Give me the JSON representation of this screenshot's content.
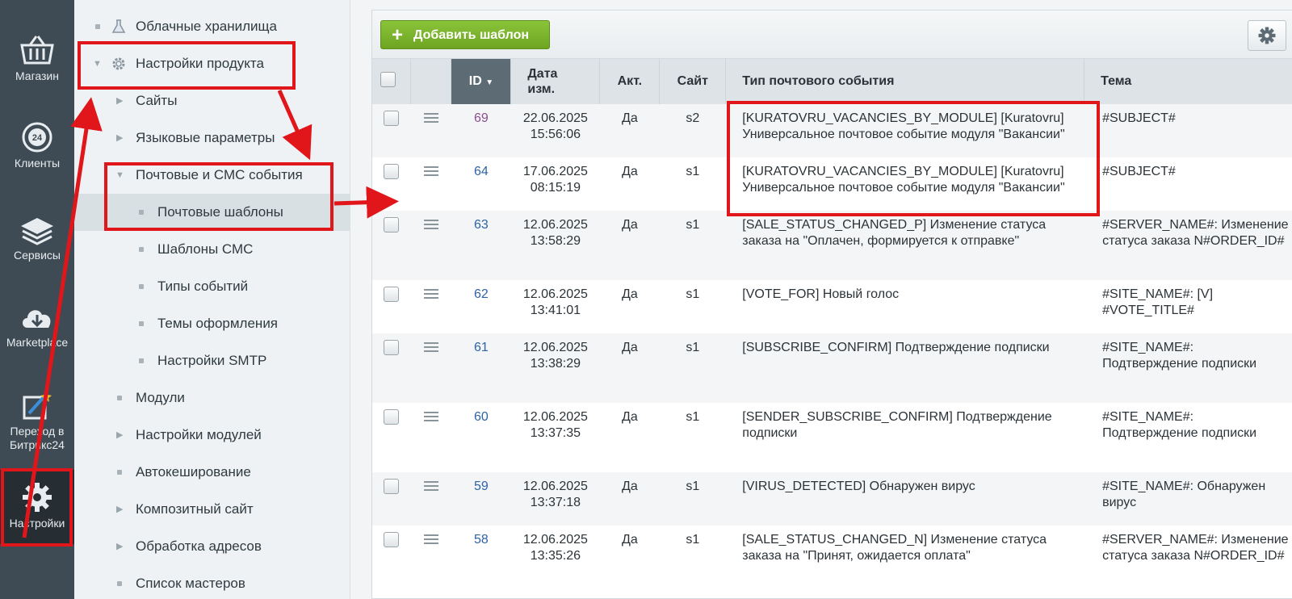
{
  "leftbar": {
    "items": [
      {
        "label": "Магазин",
        "icon": "basket-icon"
      },
      {
        "label": "Клиенты",
        "icon": "clients-24-icon"
      },
      {
        "label": "Сервисы",
        "icon": "layers-icon"
      },
      {
        "label": "Marketplace",
        "icon": "cloud-download-icon"
      },
      {
        "label": "Переход в Битрикс24",
        "icon": "magic-wand-icon"
      },
      {
        "label": "Настройки",
        "icon": "gear-icon"
      }
    ]
  },
  "tree": {
    "items": [
      {
        "label": "Облачные хранилища"
      },
      {
        "label": "Настройки продукта"
      },
      {
        "label": "Сайты"
      },
      {
        "label": "Языковые параметры"
      },
      {
        "label": "Почтовые и СМС события"
      },
      {
        "label": "Почтовые шаблоны"
      },
      {
        "label": "Шаблоны СМС"
      },
      {
        "label": "Типы событий"
      },
      {
        "label": "Темы оформления"
      },
      {
        "label": "Настройки SMTP"
      },
      {
        "label": "Модули"
      },
      {
        "label": "Настройки модулей"
      },
      {
        "label": "Автокеширование"
      },
      {
        "label": "Композитный сайт"
      },
      {
        "label": "Обработка адресов"
      },
      {
        "label": "Список мастеров"
      }
    ]
  },
  "toolbar": {
    "add_label": "Добавить шаблон",
    "accent": "#7ab32e"
  },
  "table": {
    "headers": {
      "id": "ID",
      "date": "Дата изм.",
      "active": "Акт.",
      "site": "Сайт",
      "event_type": "Тип почтового события",
      "subject": "Тема"
    },
    "rows": [
      {
        "id": "69",
        "date": "22.06.2025",
        "time": "15:56:06",
        "active": "Да",
        "site": "s2",
        "event": "[KURATOVRU_VACANCIES_BY_MODULE] [Kuratovru] Универсальное почтовое событие модуля \"Вакансии\"",
        "subject": "#SUBJECT#"
      },
      {
        "id": "64",
        "date": "17.06.2025",
        "time": "08:15:19",
        "active": "Да",
        "site": "s1",
        "event": "[KURATOVRU_VACANCIES_BY_MODULE] [Kuratovru] Универсальное почтовое событие модуля \"Вакансии\"",
        "subject": "#SUBJECT#"
      },
      {
        "id": "63",
        "date": "12.06.2025",
        "time": "13:58:29",
        "active": "Да",
        "site": "s1",
        "event": "[SALE_STATUS_CHANGED_P] Изменение статуса заказа на \"Оплачен, формируется к отправке\"",
        "subject": "#SERVER_NAME#: Изменение статуса заказа N#ORDER_ID#"
      },
      {
        "id": "62",
        "date": "12.06.2025",
        "time": "13:41:01",
        "active": "Да",
        "site": "s1",
        "event": "[VOTE_FOR] Новый голос",
        "subject": "#SITE_NAME#: [V] #VOTE_TITLE#"
      },
      {
        "id": "61",
        "date": "12.06.2025",
        "time": "13:38:29",
        "active": "Да",
        "site": "s1",
        "event": "[SUBSCRIBE_CONFIRM] Подтверждение подписки",
        "subject": "#SITE_NAME#: Подтверждение подписки"
      },
      {
        "id": "60",
        "date": "12.06.2025",
        "time": "13:37:35",
        "active": "Да",
        "site": "s1",
        "event": "[SENDER_SUBSCRIBE_CONFIRM] Подтверждение подписки",
        "subject": "#SITE_NAME#: Подтверждение подписки"
      },
      {
        "id": "59",
        "date": "12.06.2025",
        "time": "13:37:18",
        "active": "Да",
        "site": "s1",
        "event": "[VIRUS_DETECTED] Обнаружен вирус",
        "subject": "#SITE_NAME#: Обнаружен вирус"
      },
      {
        "id": "58",
        "date": "12.06.2025",
        "time": "13:35:26",
        "active": "Да",
        "site": "s1",
        "event": "[SALE_STATUS_CHANGED_N] Изменение статуса заказа на \"Принят, ожидается оплата\"",
        "subject": "#SERVER_NAME#: Изменение статуса заказа N#ORDER_ID#"
      }
    ]
  },
  "annotation_color": "#e0161b"
}
